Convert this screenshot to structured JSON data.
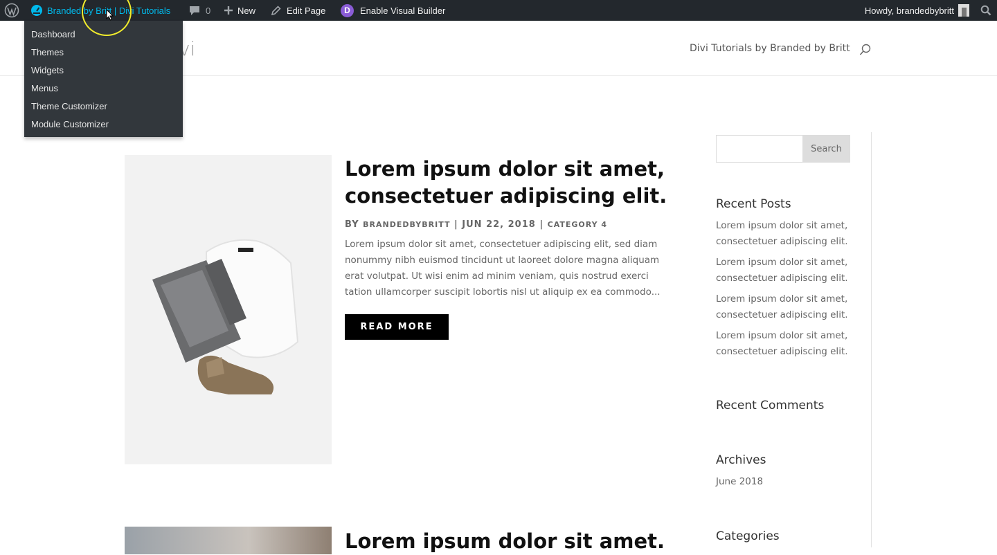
{
  "admin_bar": {
    "site_name": "Branded by Britt | Divi Tutorials",
    "comment_count": "0",
    "new_label": "New",
    "edit_page_label": "Edit Page",
    "divi_badge": "D",
    "visual_builder_label": "Enable Visual Builder",
    "howdy": "Howdy, brandedbybritt"
  },
  "site_menu": {
    "items": [
      "Dashboard",
      "Themes",
      "Widgets",
      "Menus",
      "Theme Customizer",
      "Module Customizer"
    ]
  },
  "header": {
    "logo_fragment": "vi",
    "nav_link": "Divi Tutorials by Branded by Britt"
  },
  "posts": [
    {
      "title": "Lorem ipsum dolor sit amet, consectetuer adipiscing elit.",
      "meta_by": "by",
      "author": "brandedbybritt",
      "date": "Jun 22, 2018",
      "category": "Category 4",
      "excerpt": "Lorem ipsum dolor sit amet, consectetuer adipiscing elit, sed diam nonummy nibh euismod tincidunt ut laoreet dolore magna aliquam erat volutpat. Ut wisi enim ad minim veniam, quis nostrud exerci tation ullamcorper suscipit lobortis nisl ut aliquip ex ea commodo...",
      "read_more": "READ MORE"
    },
    {
      "title": "Lorem ipsum dolor sit amet."
    }
  ],
  "sidebar": {
    "search_button": "Search",
    "recent_posts_title": "Recent Posts",
    "recent_posts": [
      "Lorem ipsum dolor sit amet, consectetuer adipiscing elit.",
      "Lorem ipsum dolor sit amet, consectetuer adipiscing elit.",
      "Lorem ipsum dolor sit amet, consectetuer adipiscing elit.",
      "Lorem ipsum dolor sit amet, consectetuer adipiscing elit."
    ],
    "recent_comments_title": "Recent Comments",
    "archives_title": "Archives",
    "archives": [
      "June 2018"
    ],
    "categories_title": "Categories"
  },
  "colors": {
    "admin_bar_bg": "#23282d",
    "admin_menu_bg": "#32373c",
    "site_name_active": "#00b9eb",
    "divi_purple": "#8a5cd6",
    "button_black": "#000000"
  }
}
